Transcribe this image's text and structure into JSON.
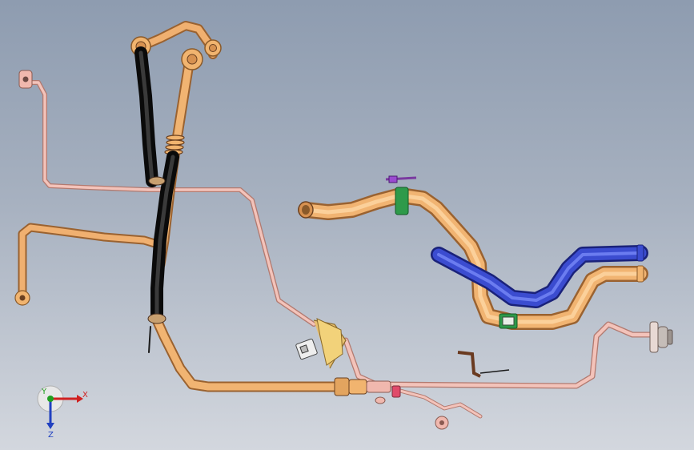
{
  "triad": {
    "x_label": "X",
    "y_label": "Y",
    "z_label": "Z"
  },
  "colors": {
    "copper_pipe": "#e8a25a",
    "pink_line": "#f0b8ae",
    "black_hose": "#1c1c1c",
    "blue_pipe": "#3344c0",
    "green_clamp": "#2e9a4a",
    "axis_x": "#d02020",
    "axis_y": "#20a020",
    "axis_z": "#2040c0"
  }
}
